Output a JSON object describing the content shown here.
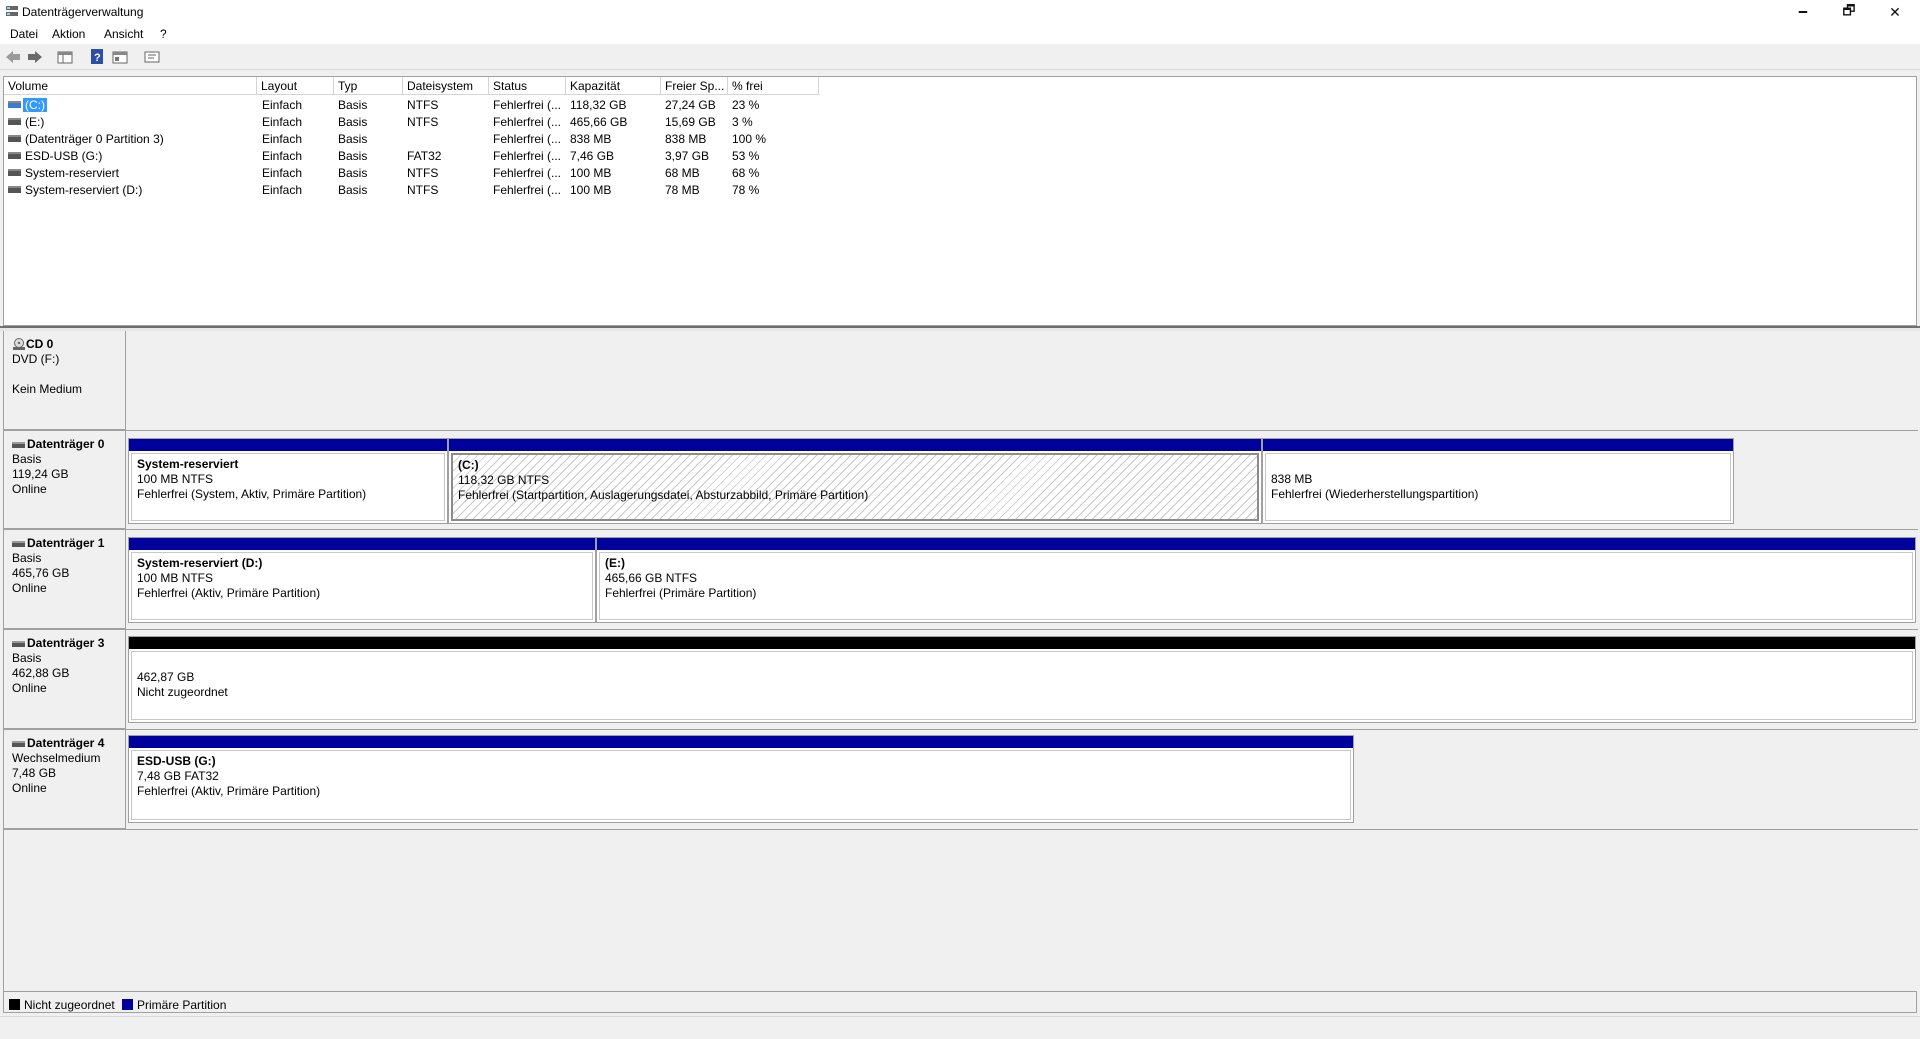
{
  "window": {
    "title": "Datenträgerverwaltung",
    "minimize": "🗕",
    "maximize": "🗗",
    "close": "✕"
  },
  "menu": [
    "Datei",
    "Aktion",
    "Ansicht",
    "?"
  ],
  "toolbar": [
    "back-arrow-icon",
    "forward-arrow-icon",
    "console-view-icon",
    "help-icon",
    "properties-icon",
    "list-view-icon"
  ],
  "volume_table": {
    "columns": [
      "Volume",
      "Layout",
      "Typ",
      "Dateisystem",
      "Status",
      "Kapazität",
      "Freier Sp...",
      "% frei"
    ],
    "rows": [
      [
        "(C:)",
        "Einfach",
        "Basis",
        "NTFS",
        "Fehlerfrei (...",
        "118,32 GB",
        "27,24 GB",
        "23 %"
      ],
      [
        "(E:)",
        "Einfach",
        "Basis",
        "NTFS",
        "Fehlerfrei (...",
        "465,66 GB",
        "15,69 GB",
        "3 %"
      ],
      [
        "(Datenträger 0 Partition 3)",
        "Einfach",
        "Basis",
        "",
        "Fehlerfrei (...",
        "838 MB",
        "838 MB",
        "100 %"
      ],
      [
        "ESD-USB (G:)",
        "Einfach",
        "Basis",
        "FAT32",
        "Fehlerfrei (...",
        "7,46 GB",
        "3,97 GB",
        "53 %"
      ],
      [
        "System-reserviert",
        "Einfach",
        "Basis",
        "NTFS",
        "Fehlerfrei (...",
        "100 MB",
        "68 MB",
        "68 %"
      ],
      [
        "System-reserviert (D:)",
        "Einfach",
        "Basis",
        "NTFS",
        "Fehlerfrei (...",
        "100 MB",
        "78 MB",
        "78 %"
      ]
    ]
  },
  "disks": {
    "cd0": {
      "name": "CD 0",
      "line1": "DVD (F:)",
      "line2": "Kein Medium"
    },
    "d0": {
      "name": "Datenträger 0",
      "type": "Basis",
      "size": "119,24 GB",
      "state": "Online",
      "parts": [
        {
          "name": "System-reserviert",
          "size": "100 MB NTFS",
          "status": "Fehlerfrei (System, Aktiv, Primäre Partition)"
        },
        {
          "name": "(C:)",
          "size": "118,32 GB NTFS",
          "status": "Fehlerfrei (Startpartition, Auslagerungsdatei, Absturzabbild, Primäre Partition)"
        },
        {
          "name": "",
          "size": "838 MB",
          "status": "Fehlerfrei (Wiederherstellungspartition)"
        }
      ]
    },
    "d1": {
      "name": "Datenträger 1",
      "type": "Basis",
      "size": "465,76 GB",
      "state": "Online",
      "parts": [
        {
          "name": "System-reserviert  (D:)",
          "size": "100 MB NTFS",
          "status": "Fehlerfrei (Aktiv, Primäre Partition)"
        },
        {
          "name": "(E:)",
          "size": "465,66 GB NTFS",
          "status": "Fehlerfrei (Primäre Partition)"
        }
      ]
    },
    "d3": {
      "name": "Datenträger 3",
      "type": "Basis",
      "size": "462,88 GB",
      "state": "Online",
      "parts": [
        {
          "size": "462,87 GB",
          "status": "Nicht zugeordnet"
        }
      ]
    },
    "d4": {
      "name": "Datenträger 4",
      "type": "Wechselmedium",
      "size": "7,48 GB",
      "state": "Online",
      "parts": [
        {
          "name": "ESD-USB  (G:)",
          "size": "7,48 GB FAT32",
          "status": "Fehlerfrei (Aktiv, Primäre Partition)"
        }
      ]
    }
  },
  "legend": [
    {
      "label": "Nicht zugeordnet",
      "color": "#000000"
    },
    {
      "label": "Primäre Partition",
      "color": "#00009c"
    }
  ],
  "colors": {
    "primary_partition": "#00009c",
    "unallocated": "#000000",
    "selection": "#3399ff"
  }
}
